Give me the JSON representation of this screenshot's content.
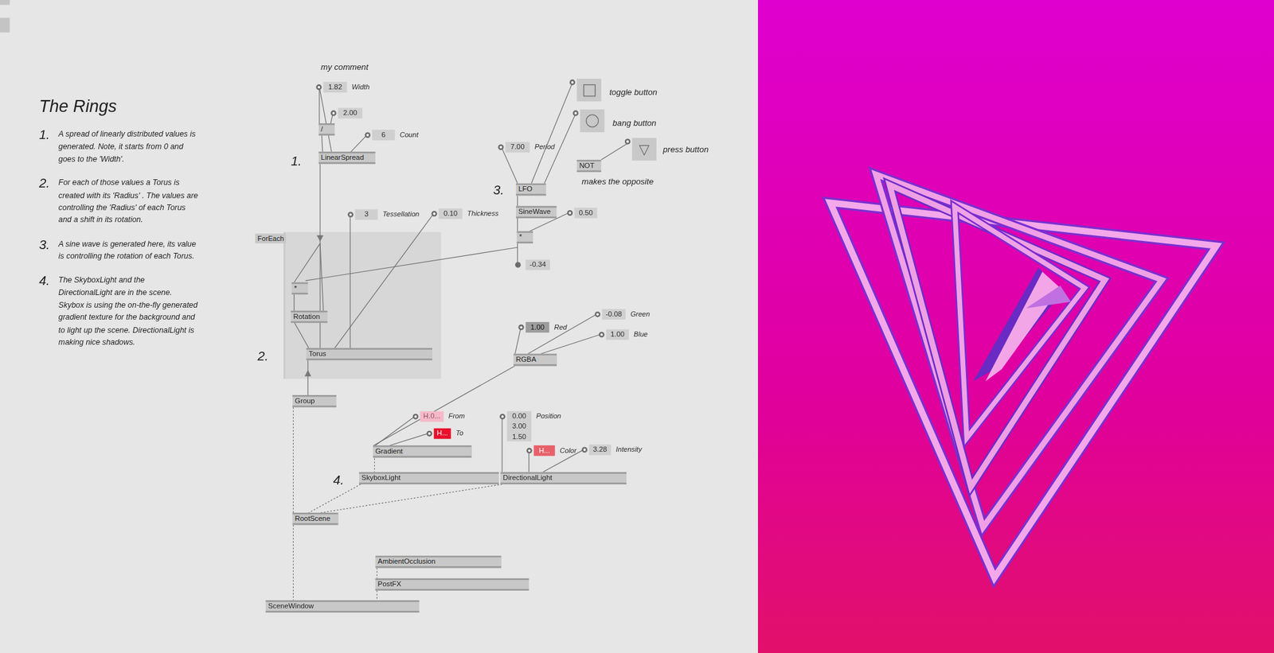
{
  "notes": {
    "title": "The Rings",
    "steps": [
      {
        "number": "1.",
        "text": "A spread of linearly distributed values is generated. Note, it starts from 0 and goes to the 'Width'."
      },
      {
        "number": "2.",
        "text": "For each of those values a Torus is created with its 'Radius' . The values are controlling the 'Radius' of each Torus and a shift in its rotation."
      },
      {
        "number": "3.",
        "text": "A sine wave is generated here, its value is controlling the rotation of each Torus."
      },
      {
        "number": "4.",
        "text": "The SkyboxLight and the DirectionalLight are in the scene. Skybox is using the on-the-fly generated gradient texture for the background and to light up the scene. DirectionalLight is making nice shadows."
      }
    ]
  },
  "comments": [
    "my comment",
    "makes the opposite"
  ],
  "section_labels": [
    "1.",
    "2.",
    "3.",
    "4."
  ],
  "region": {
    "label": "ForEach"
  },
  "ioboxes": [
    {
      "kind": "number",
      "value": "1.82",
      "label": "Width",
      "hovered": false
    },
    {
      "kind": "number",
      "value": "2.00",
      "hovered": false
    },
    {
      "kind": "number",
      "value": "6",
      "label": "Count",
      "hovered": false
    },
    {
      "kind": "number",
      "value": "3",
      "label": "Tessellation",
      "hovered": false
    },
    {
      "kind": "number",
      "value": "0.10",
      "label": "Thickness",
      "hovered": false
    },
    {
      "kind": "number",
      "value": "7.00",
      "label": "Period",
      "hovered": false
    },
    {
      "kind": "number",
      "value": "0.50",
      "hovered": false
    },
    {
      "kind": "output",
      "value": "-0.34",
      "hovered": false
    },
    {
      "kind": "number",
      "value": "1.00",
      "label": "Red",
      "hovered": true
    },
    {
      "kind": "number",
      "value": "-0.08",
      "label": "Green",
      "hovered": false
    },
    {
      "kind": "number",
      "value": "1.00",
      "label": "Blue",
      "hovered": false
    },
    {
      "kind": "color",
      "value": "H.0...",
      "label": "From",
      "color": "#f6b9c9",
      "hovered": false
    },
    {
      "kind": "color",
      "value": "H...",
      "label": "To",
      "color": "#e8102a",
      "hovered": false
    },
    {
      "kind": "vector",
      "values": [
        "0.00",
        "3.00",
        "1.50"
      ],
      "label": "Position",
      "hovered": false
    },
    {
      "kind": "color",
      "value": "H...",
      "label": "Color",
      "color": "#e8606a",
      "hovered": false
    },
    {
      "kind": "number",
      "value": "3.28",
      "label": "Intensity",
      "hovered": false
    }
  ],
  "buttons": [
    {
      "kind": "toggle",
      "label": "toggle button",
      "on": false
    },
    {
      "kind": "bang",
      "label": "bang button",
      "on": false
    },
    {
      "kind": "press",
      "label": "press button",
      "icon": "▽",
      "on": false
    }
  ],
  "nodes": [
    {
      "label": "/"
    },
    {
      "label": "LinearSpread"
    },
    {
      "label": "*"
    },
    {
      "label": "Rotation"
    },
    {
      "label": "Torus"
    },
    {
      "label": "Group"
    },
    {
      "label": "LFO"
    },
    {
      "label": "SineWave"
    },
    {
      "label": "*"
    },
    {
      "label": "NOT"
    },
    {
      "label": "RGBA"
    },
    {
      "label": "Gradient"
    },
    {
      "label": "SkyboxLight"
    },
    {
      "label": "DirectionalLight"
    },
    {
      "label": "RootScene"
    },
    {
      "label": "AmbientOcclusion"
    },
    {
      "label": "PostFX"
    },
    {
      "label": "SceneWindow"
    }
  ]
}
